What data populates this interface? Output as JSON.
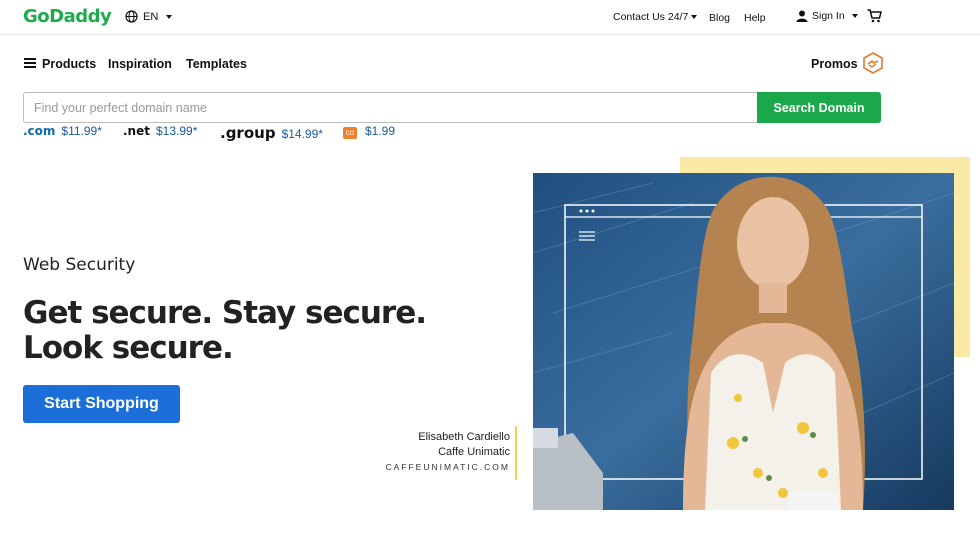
{
  "brand": {
    "logo_text": "GoDaddy"
  },
  "header": {
    "language": "EN",
    "contact": "Contact Us 24/7",
    "blog": "Blog",
    "help": "Help",
    "sign_in": "Sign In"
  },
  "nav": {
    "items": [
      "Products",
      "Inspiration",
      "Templates"
    ],
    "promos": "Promos"
  },
  "search": {
    "placeholder": "Find your perfect domain name",
    "button": "Search Domain"
  },
  "tlds": [
    {
      "ext": ".com",
      "price": "$11.99*"
    },
    {
      "ext": ".net",
      "price": "$13.99*"
    },
    {
      "ext": ".group",
      "price": "$14.99*"
    },
    {
      "ext": "co",
      "price": "$1.99"
    }
  ],
  "hero": {
    "eyebrow": "Web Security",
    "headline_line1": "Get secure. Stay secure.",
    "headline_line2": "Look secure.",
    "cta": "Start Shopping"
  },
  "caption": {
    "name": "Elisabeth Cardiello",
    "company": "Caffe Unimatic",
    "site": "CAFFEUNIMATIC.COM"
  },
  "icons": {
    "globe": "globe-icon",
    "user": "user-icon",
    "cart": "cart-icon",
    "menu": "hamburger-icon",
    "promo": "handshake-badge-icon"
  },
  "colors": {
    "brand_green": "#1cac4a",
    "search_green": "#1aa84a",
    "cta_blue": "#1c6fd8",
    "price_blue": "#1a5aa0",
    "accent_yellow": "#f4d34c"
  }
}
